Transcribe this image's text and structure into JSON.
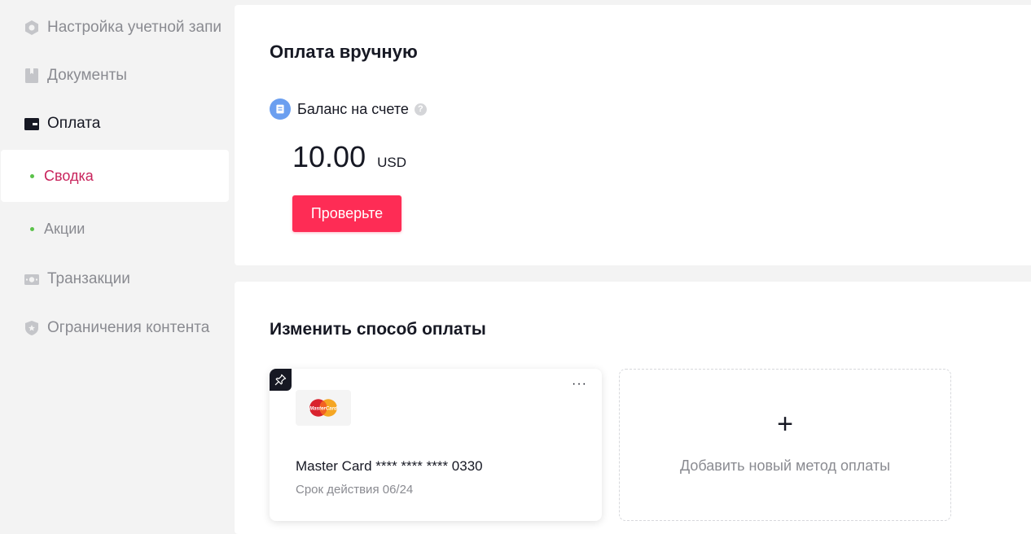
{
  "sidebar": {
    "items": [
      {
        "label": "Настройка учетной запи",
        "icon": "account-settings-icon"
      },
      {
        "label": "Документы",
        "icon": "document-icon"
      },
      {
        "label": "Оплата",
        "icon": "wallet-icon"
      },
      {
        "label": "Транзакции",
        "icon": "transactions-icon"
      },
      {
        "label": "Ограничения контента",
        "icon": "shield-icon"
      }
    ],
    "payment_sub": [
      {
        "label": "Сводка"
      },
      {
        "label": "Акции"
      }
    ]
  },
  "manual_payment": {
    "title": "Оплата вручную",
    "balance_label": "Баланс на счете",
    "help_glyph": "?",
    "amount": "10.00",
    "currency": "USD",
    "check_button": "Проверьте"
  },
  "payment_method": {
    "title": "Изменить способ оплаты",
    "card": {
      "brand_logo_text": "MasterCard",
      "number": "Master Card **** **** **** 0330",
      "expiry": "Срок действия 06/24",
      "more_glyph": "···"
    },
    "add_new": {
      "plus_glyph": "+",
      "label": "Добавить новый метод оплаты"
    }
  },
  "colors": {
    "accent": "#fe2c55",
    "selected_text": "#c8245c",
    "sub_dot": "#5bc24a",
    "balance_icon": "#6b9ff0"
  }
}
